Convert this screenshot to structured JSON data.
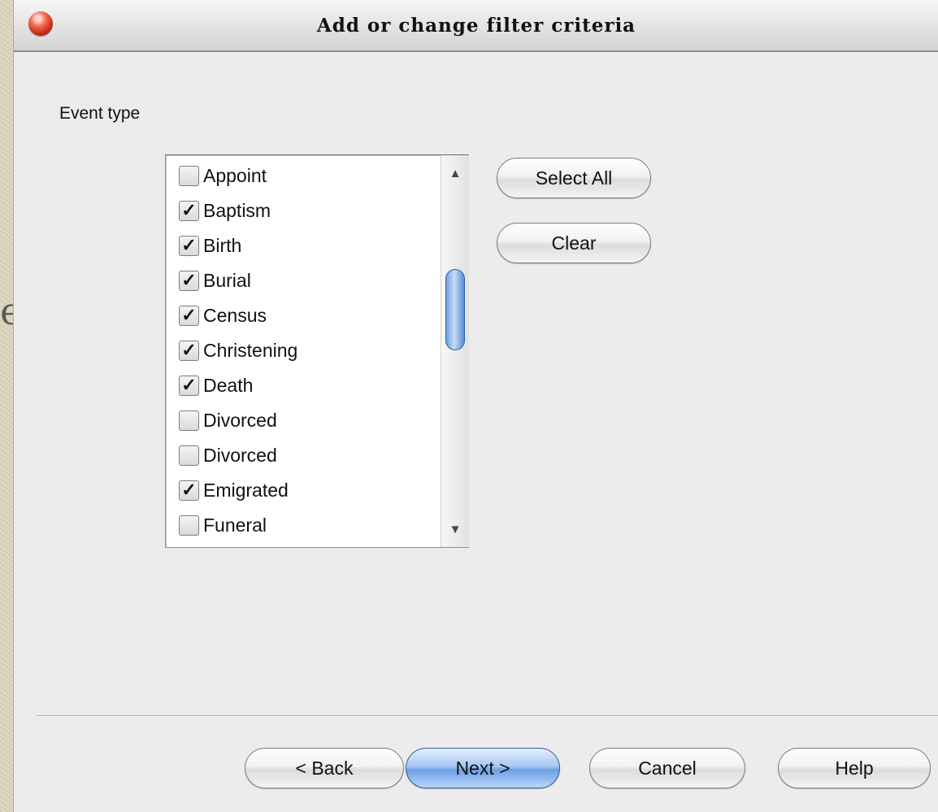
{
  "window": {
    "title": "Add or change filter criteria"
  },
  "form": {
    "event_type_label": "Event type"
  },
  "event_types": [
    {
      "label": "Appoint",
      "checked": false
    },
    {
      "label": "Baptism",
      "checked": true
    },
    {
      "label": "Birth",
      "checked": true
    },
    {
      "label": "Burial",
      "checked": true
    },
    {
      "label": "Census",
      "checked": true
    },
    {
      "label": "Christening",
      "checked": true
    },
    {
      "label": "Death",
      "checked": true
    },
    {
      "label": "Divorced",
      "checked": false
    },
    {
      "label": "Divorced",
      "checked": false
    },
    {
      "label": "Emigrated",
      "checked": true
    },
    {
      "label": "Funeral",
      "checked": false
    }
  ],
  "side_buttons": {
    "select_all": "Select All",
    "clear": "Clear"
  },
  "footer_buttons": {
    "back": "< Back",
    "next": "Next >",
    "cancel": "Cancel",
    "help": "Help"
  },
  "annotation": {
    "text": "ents"
  },
  "icons": {
    "check": "check-icon",
    "scroll_up": "arrow-up-icon",
    "scroll_down": "arrow-down-icon",
    "close": "close-icon"
  },
  "colors": {
    "annotation_arrow": "#b3231c",
    "primary_button": "#6e9fe3",
    "close_button": "#d8341c"
  }
}
